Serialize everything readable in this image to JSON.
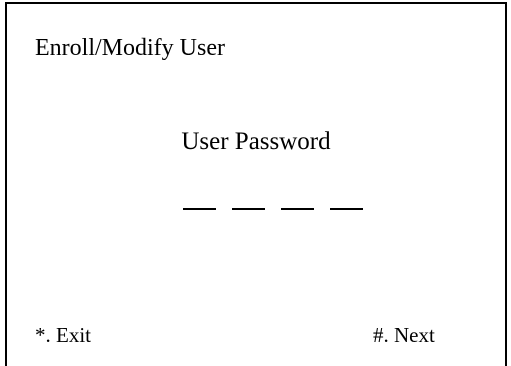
{
  "screen": {
    "title": "Enroll/Modify User",
    "field_label": "User Password",
    "pin": {
      "length": 4,
      "entered": 0
    }
  },
  "softkeys": {
    "exit_label": "*. Exit",
    "next_label": "#. Next"
  }
}
